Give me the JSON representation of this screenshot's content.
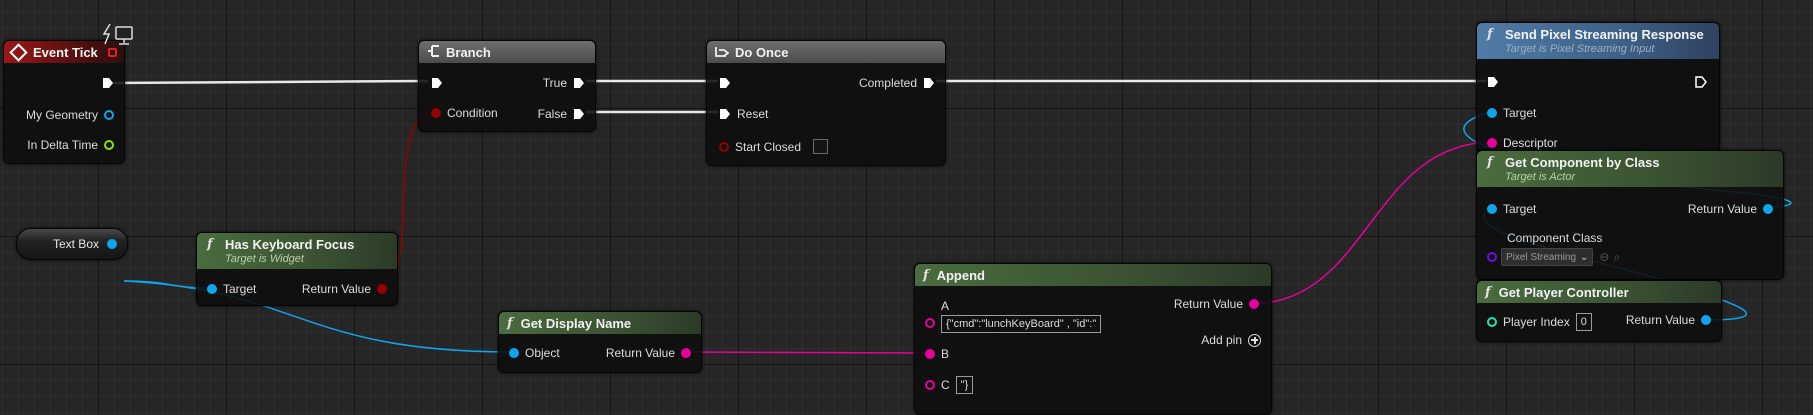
{
  "nodes": {
    "event_tick": {
      "title": "Event Tick",
      "pins": {
        "geometry": "My Geometry",
        "delta": "In Delta Time"
      }
    },
    "branch": {
      "title": "Branch",
      "pins": {
        "condition": "Condition",
        "true": "True",
        "false": "False"
      }
    },
    "do_once": {
      "title": "Do Once",
      "pins": {
        "completed": "Completed",
        "reset": "Reset",
        "start_closed": "Start Closed"
      }
    },
    "send_response": {
      "title": "Send Pixel Streaming Response",
      "subtitle": "Target is Pixel Streaming Input",
      "pins": {
        "target": "Target",
        "descriptor": "Descriptor"
      }
    },
    "get_component": {
      "title": "Get Component by Class",
      "subtitle": "Target is Actor",
      "pins": {
        "target": "Target",
        "return": "Return Value",
        "component_class": "Component Class"
      },
      "class_value": "Pixel Streaming"
    },
    "get_player_controller": {
      "title": "Get Player Controller",
      "pins": {
        "player_index": "Player Index",
        "return": "Return Value"
      },
      "player_index_value": "0"
    },
    "has_keyboard_focus": {
      "title": "Has Keyboard Focus",
      "subtitle": "Target is Widget",
      "pins": {
        "target": "Target",
        "return": "Return Value"
      }
    },
    "text_box": {
      "title": "Text Box"
    },
    "get_display_name": {
      "title": "Get Display Name",
      "pins": {
        "object": "Object",
        "return": "Return Value"
      }
    },
    "append": {
      "title": "Append",
      "pins": {
        "a": "A",
        "b": "B",
        "c": "C",
        "return": "Return Value",
        "add_pin": "Add pin"
      },
      "a_value": "{\"cmd\":\"lunchKeyBoard\" , \"id\":\"",
      "c_value": "\"}"
    }
  },
  "colors": {
    "exec_wire": "#e8e8e8",
    "bool_pin": "#950000",
    "object_pin": "#0ea5ea",
    "string_pin": "#e6009c",
    "int_pin": "#1fe3af",
    "float_pin": "#8ae600",
    "class_pin": "#6c0fe0"
  },
  "icons": {
    "event": "diamond-event-icon",
    "branch": "branch-icon",
    "do_once": "do-once-icon",
    "function": "function-f-icon",
    "screen": "monitor-icon",
    "add_pin": "plus-circle-icon"
  }
}
